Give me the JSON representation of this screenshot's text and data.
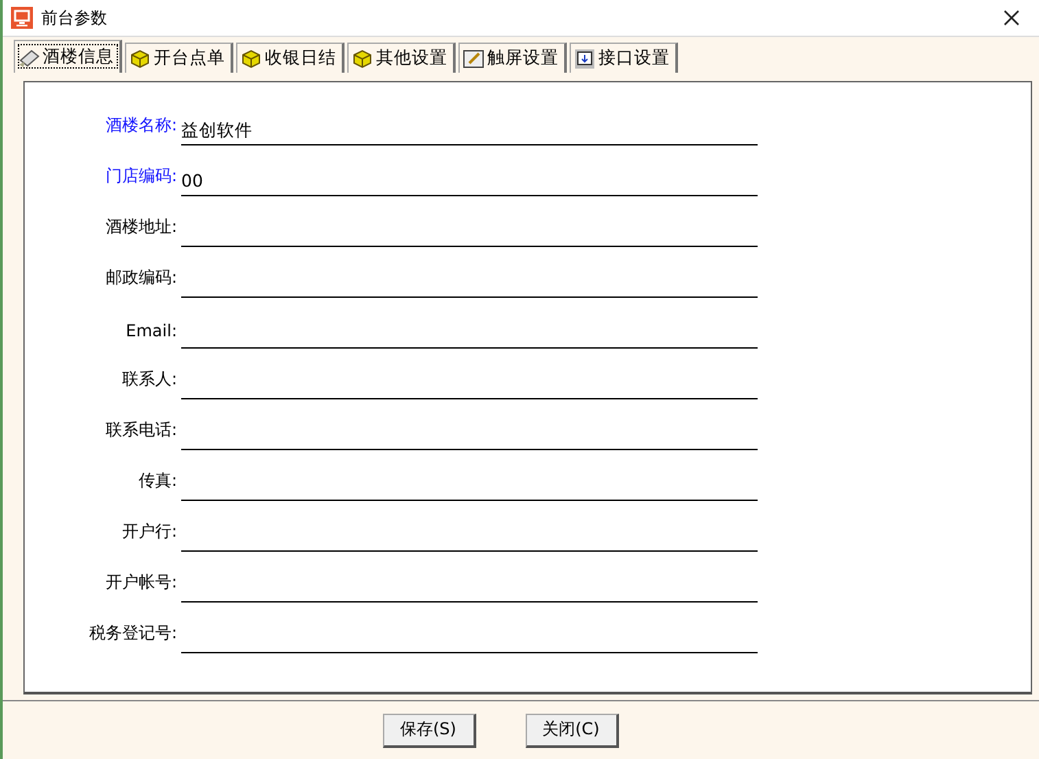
{
  "window": {
    "title": "前台参数"
  },
  "tabs": [
    {
      "label": "酒楼信息",
      "selected": true,
      "kind": "note"
    },
    {
      "label": "开台点单",
      "selected": false,
      "kind": "cube"
    },
    {
      "label": "收银日结",
      "selected": false,
      "kind": "cube"
    },
    {
      "label": "其他设置",
      "selected": false,
      "kind": "cube"
    },
    {
      "label": "触屏设置",
      "selected": false,
      "kind": "pen"
    },
    {
      "label": "接口设置",
      "selected": false,
      "kind": "monitor"
    }
  ],
  "fields": [
    {
      "label": "酒楼名称:",
      "value": "益创软件",
      "required": true
    },
    {
      "label": "门店编码:",
      "value": "00",
      "required": true
    },
    {
      "label": "酒楼地址:",
      "required": false
    },
    {
      "label": "邮政编码:",
      "required": false
    },
    {
      "label": "Email:",
      "required": false
    },
    {
      "label": "联系人:",
      "required": false
    },
    {
      "label": "联系电话:",
      "required": false
    },
    {
      "label": "传真:",
      "required": false
    },
    {
      "label": "开户行:",
      "required": false
    },
    {
      "label": "开户帐号:",
      "required": false
    },
    {
      "label": "税务登记号:",
      "required": false
    }
  ],
  "buttons": [
    "保存(S)",
    "关闭(C)"
  ]
}
